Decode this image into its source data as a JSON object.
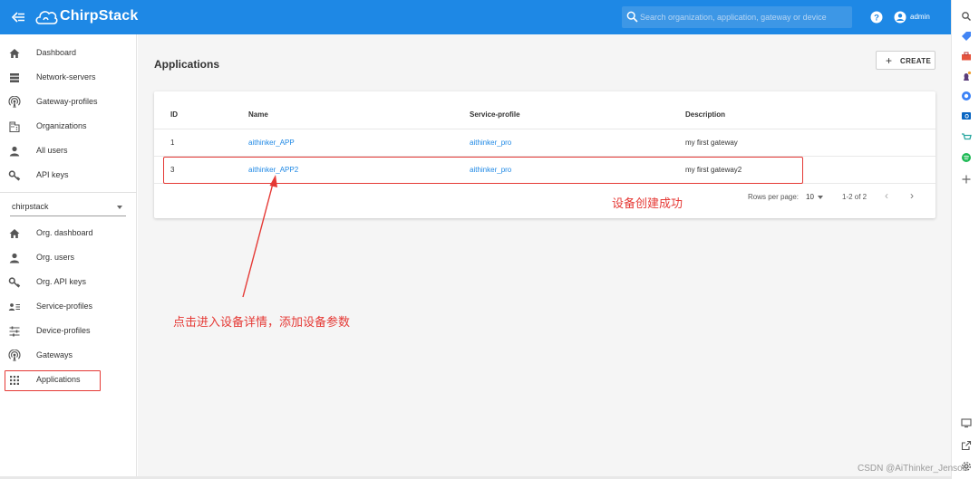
{
  "header": {
    "brand": "ChirpStack",
    "search_placeholder": "Search organization, application, gateway or device",
    "user": "admin"
  },
  "sidebar": {
    "global_items": [
      {
        "label": "Dashboard",
        "icon": "home-icon"
      },
      {
        "label": "Network-servers",
        "icon": "server-icon"
      },
      {
        "label": "Gateway-profiles",
        "icon": "radio-tower-icon"
      },
      {
        "label": "Organizations",
        "icon": "building-icon"
      },
      {
        "label": "All users",
        "icon": "person-icon"
      },
      {
        "label": "API keys",
        "icon": "key-icon"
      }
    ],
    "organization": "chirpstack",
    "org_items": [
      {
        "label": "Org. dashboard",
        "icon": "home-icon"
      },
      {
        "label": "Org. users",
        "icon": "person-icon"
      },
      {
        "label": "Org. API keys",
        "icon": "key-icon"
      },
      {
        "label": "Service-profiles",
        "icon": "account-details-icon"
      },
      {
        "label": "Device-profiles",
        "icon": "tune-icon"
      },
      {
        "label": "Gateways",
        "icon": "radio-tower-icon"
      },
      {
        "label": "Applications",
        "icon": "apps-grid-icon"
      }
    ]
  },
  "main": {
    "title": "Applications",
    "create_label": "CREATE",
    "table": {
      "headers": [
        "ID",
        "Name",
        "Service-profile",
        "Description"
      ],
      "rows": [
        {
          "id": "1",
          "name": "aithinker_APP",
          "service_profile": "aithinker_pro",
          "description": "my first gateway"
        },
        {
          "id": "3",
          "name": "aithinker_APP2",
          "service_profile": "aithinker_pro",
          "description": "my first gateway2"
        }
      ]
    },
    "pagination": {
      "rows_per_page_label": "Rows per page:",
      "rows_per_page": "10",
      "range": "1-2 of 2"
    }
  },
  "annotations": {
    "created": "设备创建成功",
    "click_hint": "点击进入设备详情，添加设备参数"
  },
  "watermark": "CSDN @AiThinker_Jenson",
  "colors": {
    "appbar": "#1e88e5",
    "link": "#1e88e5",
    "annotation": "#e53935"
  }
}
